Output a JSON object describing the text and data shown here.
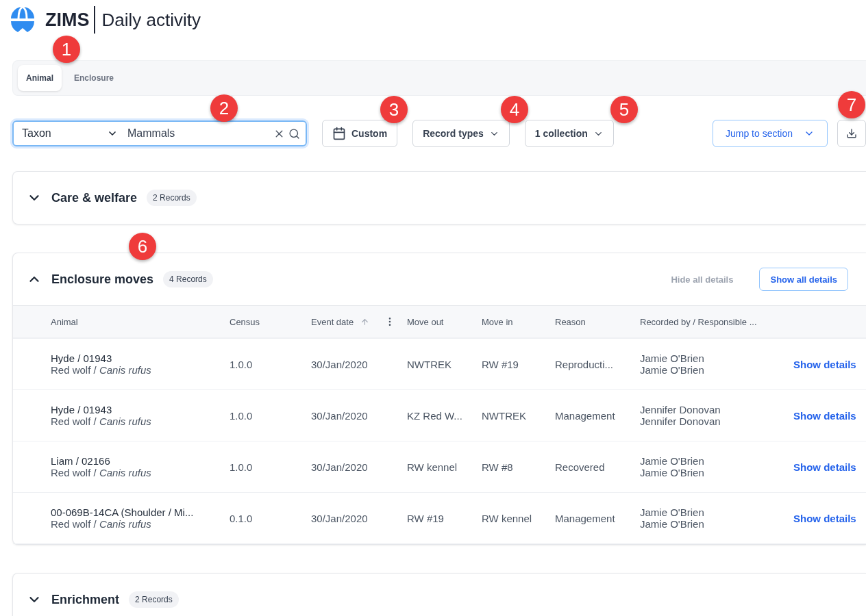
{
  "header": {
    "brand": "ZIMS",
    "title": "Daily activity"
  },
  "tabs": [
    {
      "label": "Animal",
      "selected": true
    },
    {
      "label": "Enclosure",
      "selected": false
    }
  ],
  "filters": {
    "search_type": "Taxon",
    "search_value": "Mammals",
    "date": "Custom",
    "record_types": "Record types",
    "collection": "1 collection",
    "jump": "Jump to section"
  },
  "sections": [
    {
      "title": "Care & welfare",
      "count": "2 Records",
      "expanded": false
    },
    {
      "title": "Enclosure moves",
      "count": "4 Records",
      "expanded": true,
      "hide_all": "Hide all details",
      "show_all": "Show all details",
      "columns": [
        "Animal",
        "Census",
        "Event date",
        "Move out",
        "Move in",
        "Reason",
        "Recorded by / Responsible ..."
      ],
      "rows": [
        {
          "animal": "Hyde / 01943",
          "species": "Red wolf / *Canis rufus*",
          "census": "1.0.0",
          "date": "30/Jan/2020",
          "move_out": "NWTREK",
          "move_in": "RW #19",
          "reason": "Reproducti...",
          "recorded_by": "Jamie O'Brien",
          "responsible": "Jamie O'Brien",
          "action": "Show details"
        },
        {
          "animal": "Hyde / 01943",
          "species": "Red wolf / *Canis rufus*",
          "census": "1.0.0",
          "date": "30/Jan/2020",
          "move_out": "KZ Red W...",
          "move_in": "NWTREK",
          "reason": "Management",
          "recorded_by": "Jennifer Donovan",
          "responsible": "Jennifer Donovan",
          "action": "Show details"
        },
        {
          "animal": "Liam / 02166",
          "species": "Red wolf / *Canis rufus*",
          "census": "1.0.0",
          "date": "30/Jan/2020",
          "move_out": "RW kennel",
          "move_in": "RW #8",
          "reason": "Recovered",
          "recorded_by": "Jamie O'Brien",
          "responsible": "Jamie O'Brien",
          "action": "Show details"
        },
        {
          "animal": "00-069B-14CA (Shoulder / Mi...",
          "species": "Red wolf / *Canis rufus*",
          "census": "0.1.0",
          "date": "30/Jan/2020",
          "move_out": "RW #19",
          "move_in": "RW kennel",
          "reason": "Management",
          "recorded_by": "Jamie O'Brien",
          "responsible": "Jamie O'Brien",
          "action": "Show details"
        }
      ]
    },
    {
      "title": "Enrichment",
      "count": "2 Records",
      "expanded": false
    }
  ],
  "callouts": [
    "1",
    "2",
    "3",
    "4",
    "5",
    "6",
    "7"
  ]
}
